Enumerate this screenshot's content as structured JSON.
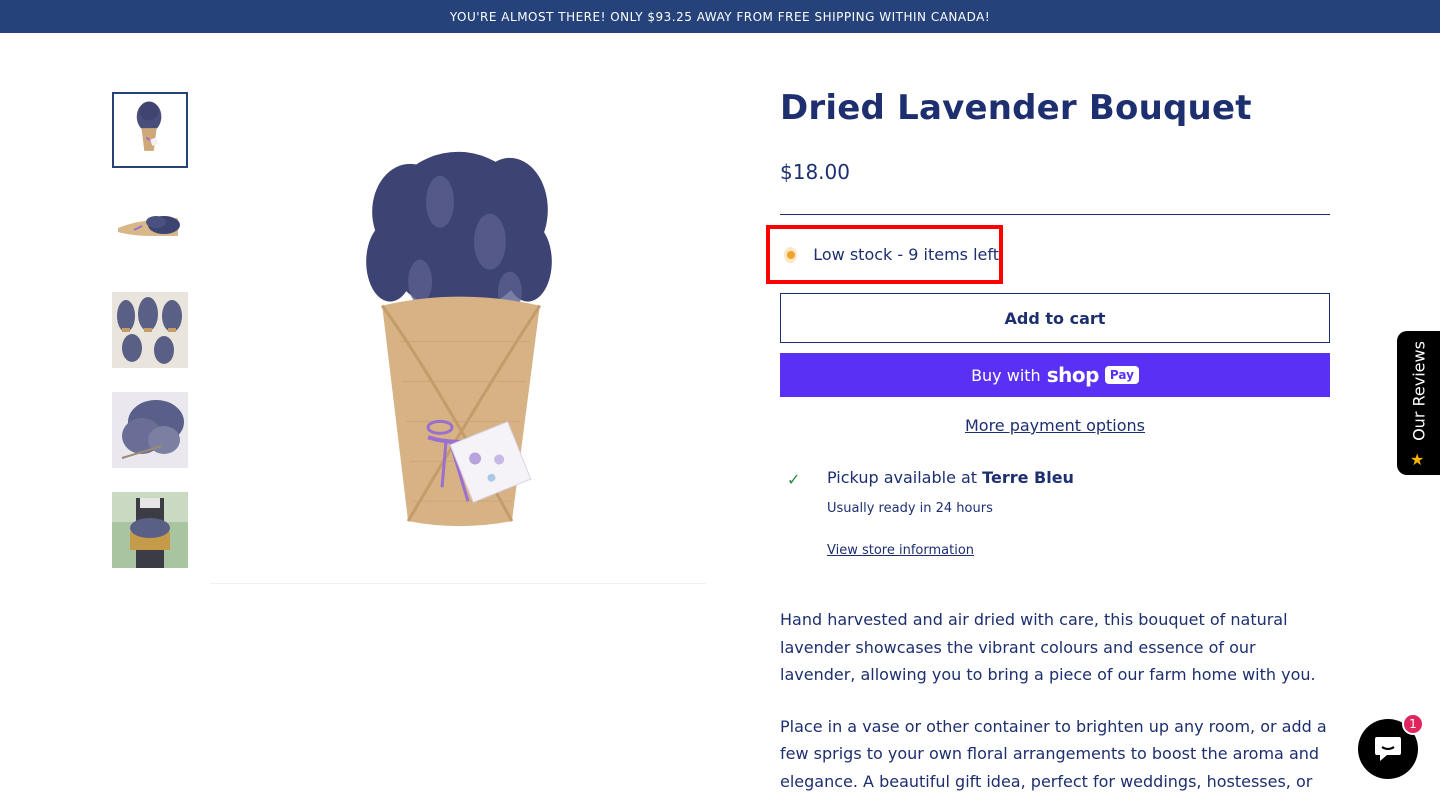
{
  "announcement": "YOU'RE ALMOST THERE! ONLY $93.25 AWAY FROM FREE SHIPPING WITHIN CANADA!",
  "product": {
    "title": "Dried Lavender Bouquet",
    "price": "$18.00",
    "stock": "Low stock - 9 items left",
    "add_to_cart": "Add to cart",
    "buy_with": "Buy with",
    "shop_word": "shop",
    "pay_word": "Pay",
    "more_payment": "More payment options"
  },
  "pickup": {
    "prefix": "Pickup available at ",
    "store": "Terre Bleu",
    "ready": "Usually ready in 24 hours",
    "link": "View store information"
  },
  "description": {
    "p1": "Hand harvested and air dried with care, this bouquet of natural lavender showcases the vibrant colours and essence of our lavender, allowing you to bring a piece of our farm home with you.",
    "p2": "Place in a vase or other container to brighten up any room, or add a few sprigs to your own floral arrangements to boost the aroma and elegance. A beautiful gift idea, perfect for weddings, hostesses, or"
  },
  "reviews_tab": "Our Reviews",
  "chat_badge": "1",
  "colors": {
    "brand": "#25427b",
    "text": "#1d2f6f",
    "shop_pay": "#5a31f4",
    "highlight": "#ff0000",
    "stock_dot": "#f0a32c"
  },
  "icons": [
    "check-icon",
    "star-icon",
    "chat-icon",
    "stock-dot-icon"
  ]
}
